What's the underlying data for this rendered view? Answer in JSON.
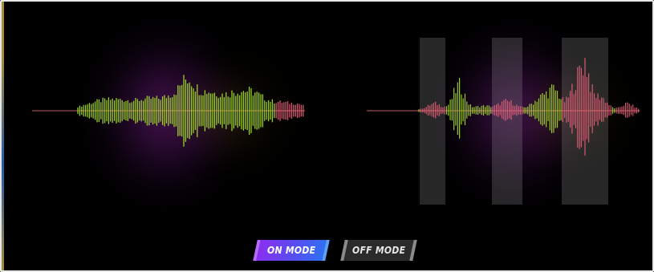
{
  "colors": {
    "background": "#000000",
    "frame_border": "#e8e8e8",
    "wave_green": "#a6e02c",
    "wave_pink": "#e8607a",
    "wave_center_line": "#d86a6a",
    "glow_purple": "#942aa5",
    "on_gradient_start": "#8a2ff0",
    "on_gradient_end": "#2f6ff2",
    "off_background": "#2b2b2b"
  },
  "controls": {
    "on_label": "ON MODE",
    "off_label": "OFF MODE",
    "active_mode": "on"
  },
  "waveforms": [
    {
      "name": "original-waveform",
      "color_scheme": "green"
    },
    {
      "name": "processed-waveform",
      "color_scheme": "green-with-pink-segments",
      "highlighted_segments": 3
    }
  ]
}
